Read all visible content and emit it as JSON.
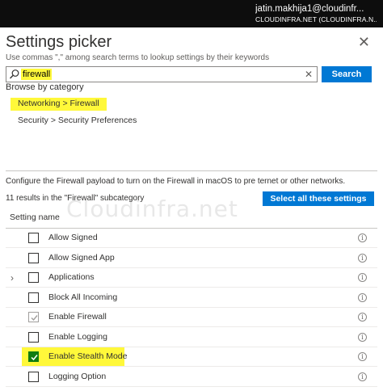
{
  "account": {
    "email": "jatin.makhija1@cloudinfr...",
    "tenant": "CLOUDINFRA.NET (CLOUDINFRA.N..."
  },
  "panel": {
    "title": "Settings picker",
    "hint": "Use commas \",\" among search terms to lookup settings by their keywords",
    "close_icon": "close-icon"
  },
  "search": {
    "query": "firewall",
    "button_label": "Search",
    "icon": "search-icon"
  },
  "browse": {
    "heading": "Browse by category",
    "categories": [
      "Networking > Firewall",
      "Security > Security Preferences"
    ]
  },
  "description": "Configure the Firewall payload to turn on the Firewall in macOS to pre ternet or other networks.",
  "results": {
    "count_text": "11 results in the \"Firewall\" subcategory",
    "select_all_label": "Select all these settings"
  },
  "watermark": "Cloudinfra.net",
  "table": {
    "column_header": "Setting name",
    "rows": [
      {
        "label": "Allow Signed",
        "checked": false,
        "expandable": false
      },
      {
        "label": "Allow Signed App",
        "checked": false,
        "expandable": false
      },
      {
        "label": "Applications",
        "checked": false,
        "expandable": true
      },
      {
        "label": "Block All Incoming",
        "checked": false,
        "expandable": false
      },
      {
        "label": "Enable Firewall",
        "checked": true,
        "disabled": true,
        "expandable": false
      },
      {
        "label": "Enable Logging",
        "checked": false,
        "expandable": false
      },
      {
        "label": "Enable Stealth Mode",
        "checked": true,
        "expandable": false
      },
      {
        "label": "Logging Option",
        "checked": false,
        "expandable": false
      }
    ]
  },
  "colors": {
    "accent": "#0078d4",
    "highlight": "#fff83a",
    "checked": "#107c10",
    "topbar": "#0d0d0d"
  }
}
